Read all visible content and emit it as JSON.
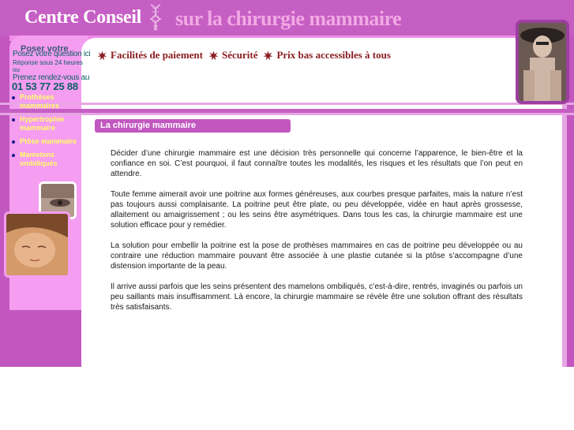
{
  "header": {
    "title": "Centre Conseil",
    "subtitle": "sur la chirurgie mammaire"
  },
  "features": [
    {
      "label": "Facilités de paiement"
    },
    {
      "label": "Sécurité"
    },
    {
      "label": "Prix bas accessibles à tous"
    }
  ],
  "contact": {
    "ghost": "Poser votre",
    "line1": "Posez votre question ici",
    "line2": "Réponse sous 24 heures",
    "line3": "ou",
    "line4": "Prenez rendez-vous au",
    "phone": "01 53 77 25 88"
  },
  "sidebar": {
    "items": [
      {
        "label": "Prothèses mammaires"
      },
      {
        "label": "Hypertrophie mammaire"
      },
      {
        "label": "Ptôse mammaire"
      },
      {
        "label": "Mamelons ombiliqués"
      }
    ]
  },
  "section": {
    "title": "La chirurgie mammaire"
  },
  "article": {
    "paragraphs": [
      "Décider d’une chirurgie mammaire est une décision très personnelle qui concerne l’apparence, le bien-être et la confiance en soi. C’est pourquoi, il faut connaître toutes les modalités, les risques et les résultats que l’on peut en attendre.",
      "Toute femme aimerait avoir une poitrine aux formes généreuses, aux courbes presque parfaites, mais la nature n’est pas toujours aussi complaisante. La poitrine peut être plate, ou peu développée, vidée en haut après grossesse, allaitement ou amaigrissement ; ou les seins être asymétriques. Dans tous les cas, la chirurgie mammaire est une solution efficace pour y remédier.",
      "La solution pour embellir la poitrine est la pose de prothèses mammaires en cas de poitrine peu développée ou au contraire une réduction mammaire pouvant être associée à une plastie cutanée si la ptôse s’accompagne d’une distension importante de la peau.",
      "Il arrive aussi parfois que les seins présentent des mamelons ombiliqués, c’est-à-dire, rentrés, invaginés ou parfois un peu saillants mais insuffisamment. Là encore, la chirurgie mammaire se révèle être une solution offrant des résultats très satisfaisants."
    ]
  },
  "colors": {
    "magenta": "#c257c0",
    "light_pink": "#f59df0",
    "feature_text": "#8b1d22",
    "nav_text": "#ffff66",
    "contact_text": "#0b5f66"
  },
  "icons": [
    "dna-icon",
    "star-icon"
  ]
}
